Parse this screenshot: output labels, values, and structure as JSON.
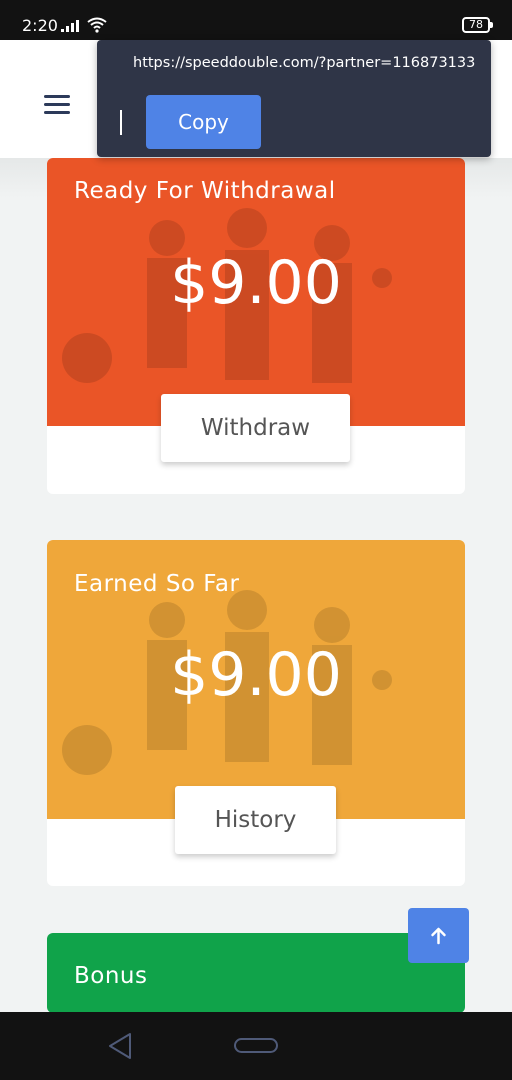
{
  "status_bar": {
    "time": "2:20",
    "battery": "78"
  },
  "popup": {
    "url": "https://speeddouble.com/?partner=116873133",
    "copy_label": "Copy"
  },
  "cards": {
    "withdrawal": {
      "title": "Ready For Withdrawal",
      "amount": "$9.00",
      "button": "Withdraw",
      "color": "#ea5527"
    },
    "earned": {
      "title": "Earned So Far",
      "amount": "$9.00",
      "button": "History",
      "color": "#efa73a"
    },
    "bonus": {
      "title": "Bonus",
      "color": "#10a34a"
    }
  },
  "icons": {
    "menu": "hamburger-icon",
    "scroll_top": "arrow-up-icon",
    "back": "triangle-back-icon",
    "home": "pill-home-icon"
  }
}
